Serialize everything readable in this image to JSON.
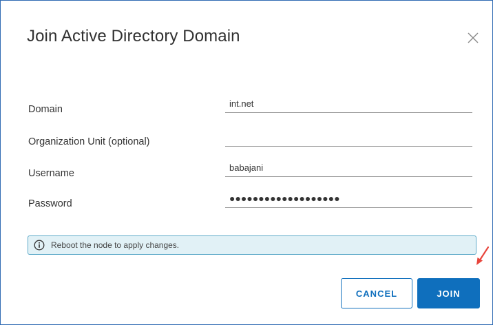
{
  "dialog": {
    "title": "Join Active Directory Domain",
    "close_icon": "close-icon"
  },
  "form": {
    "domain": {
      "label": "Domain",
      "value": "int.net"
    },
    "org_unit": {
      "label": "Organization Unit (optional)",
      "value": ""
    },
    "username": {
      "label": "Username",
      "value": "babajani"
    },
    "password": {
      "label": "Password",
      "value": "●●●●●●●●●●●●●●●●●●●"
    }
  },
  "banner": {
    "icon": "info-icon",
    "text": "Reboot the node to apply changes."
  },
  "buttons": {
    "cancel": "CANCEL",
    "join": "JOIN"
  },
  "colors": {
    "accent": "#0f6fbd",
    "banner_bg": "#e1f1f6",
    "banner_border": "#5aa8c8",
    "annotation_arrow": "#e8453c"
  }
}
